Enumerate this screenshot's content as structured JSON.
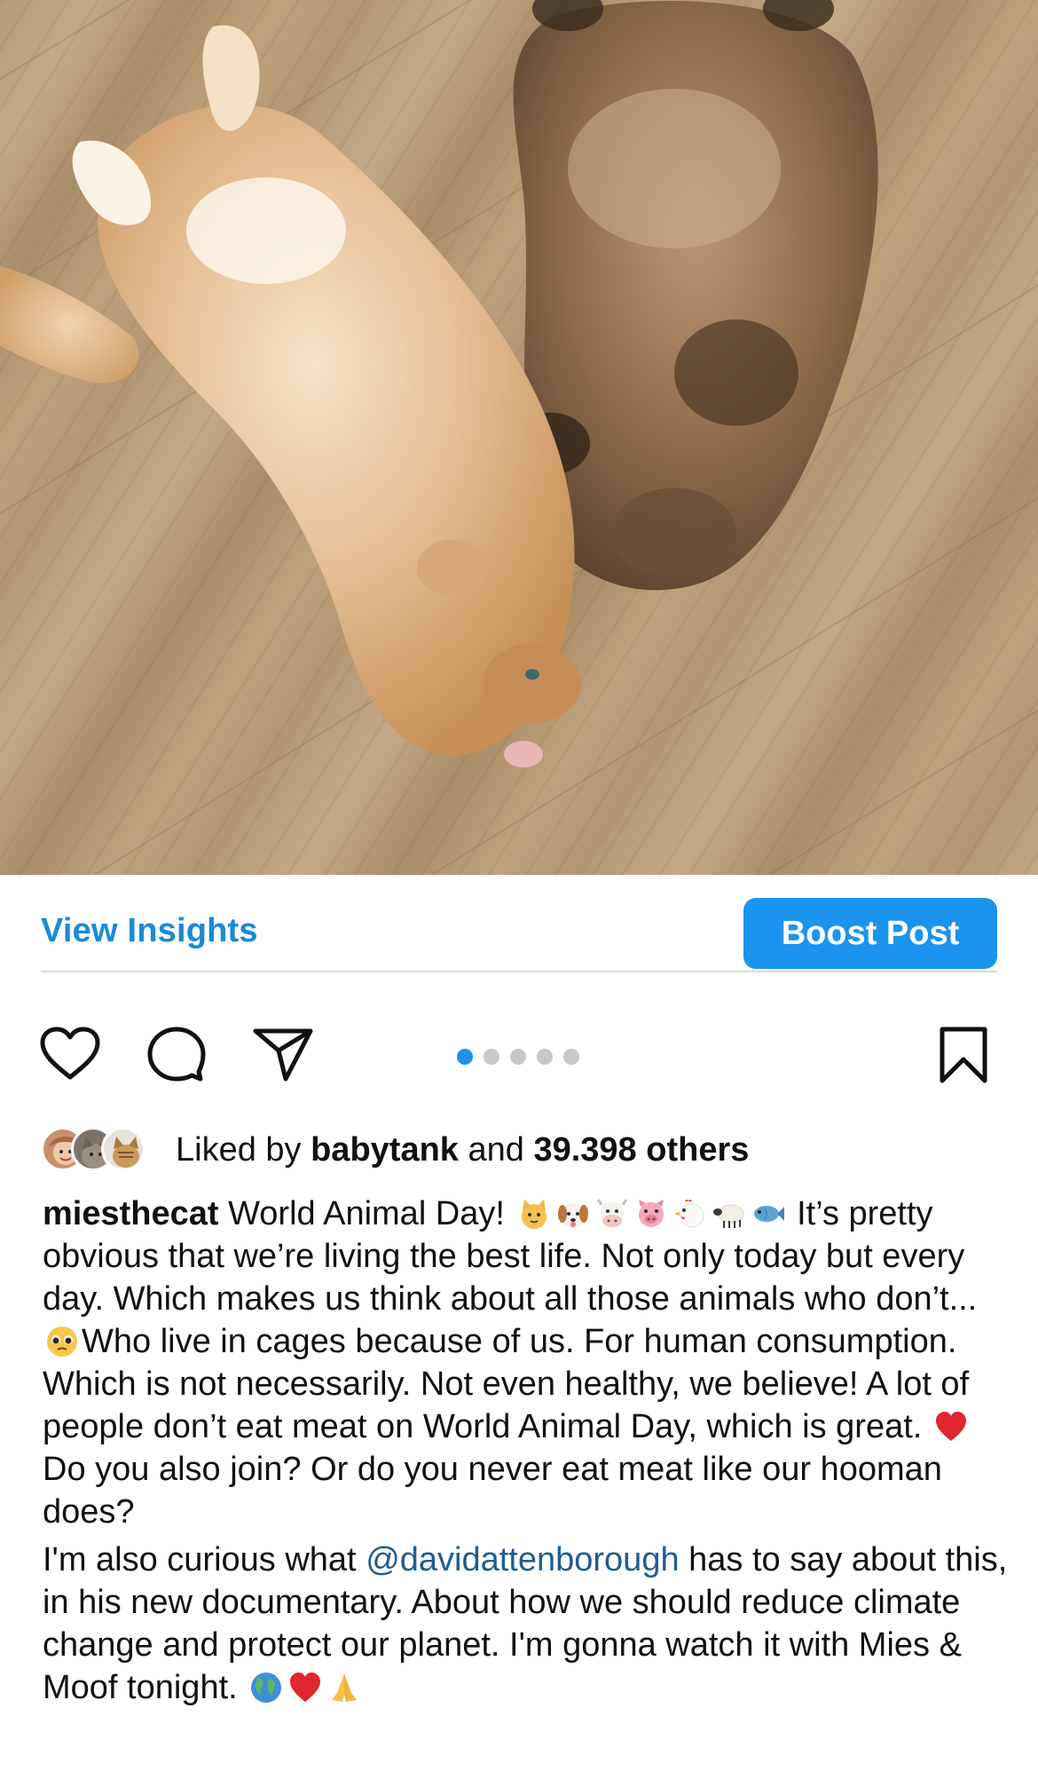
{
  "post": {
    "image_alt": "",
    "carousel": {
      "count": 5,
      "active_index": 0
    }
  },
  "insights": {
    "view_label": "View Insights",
    "boost_label": "Boost Post"
  },
  "likes": {
    "prefix": "Liked by ",
    "user": "babytank",
    "middle": " and ",
    "others": "39.398 others"
  },
  "caption": {
    "username": "miesthecat",
    "text_1": " World Animal Day! ",
    "text_2": " It’s pretty obvious that we’re living the best life. Not only today but every day. Which makes us think about all those animals who don’t... ",
    "text_3": "Who live in cages because of us. For human consumption. Which is not necessarily. Not even healthy, we believe! A lot of people don’t eat meat on World Animal Day, which is great. ",
    "text_4": " Do you also join? Or do you never eat meat like our hooman does?",
    "p2_text_1": "I'm also curious what ",
    "mention": "@davidattenborough",
    "p2_text_2": " has to say about this, in his new documentary. About how we should reduce climate change and protect our planet. I'm gonna watch it with Mies & Moof tonight. ",
    "animal_emojis": [
      "cat-face-icon",
      "dog-face-icon",
      "cow-face-icon",
      "pig-face-icon",
      "chicken-icon",
      "sheep-icon",
      "fish-icon"
    ]
  },
  "colors": {
    "accent_blue": "#1a94ee",
    "link_blue": "#1a8ad6",
    "mention_blue": "#1f5c91",
    "heart_red": "#e0262e"
  }
}
